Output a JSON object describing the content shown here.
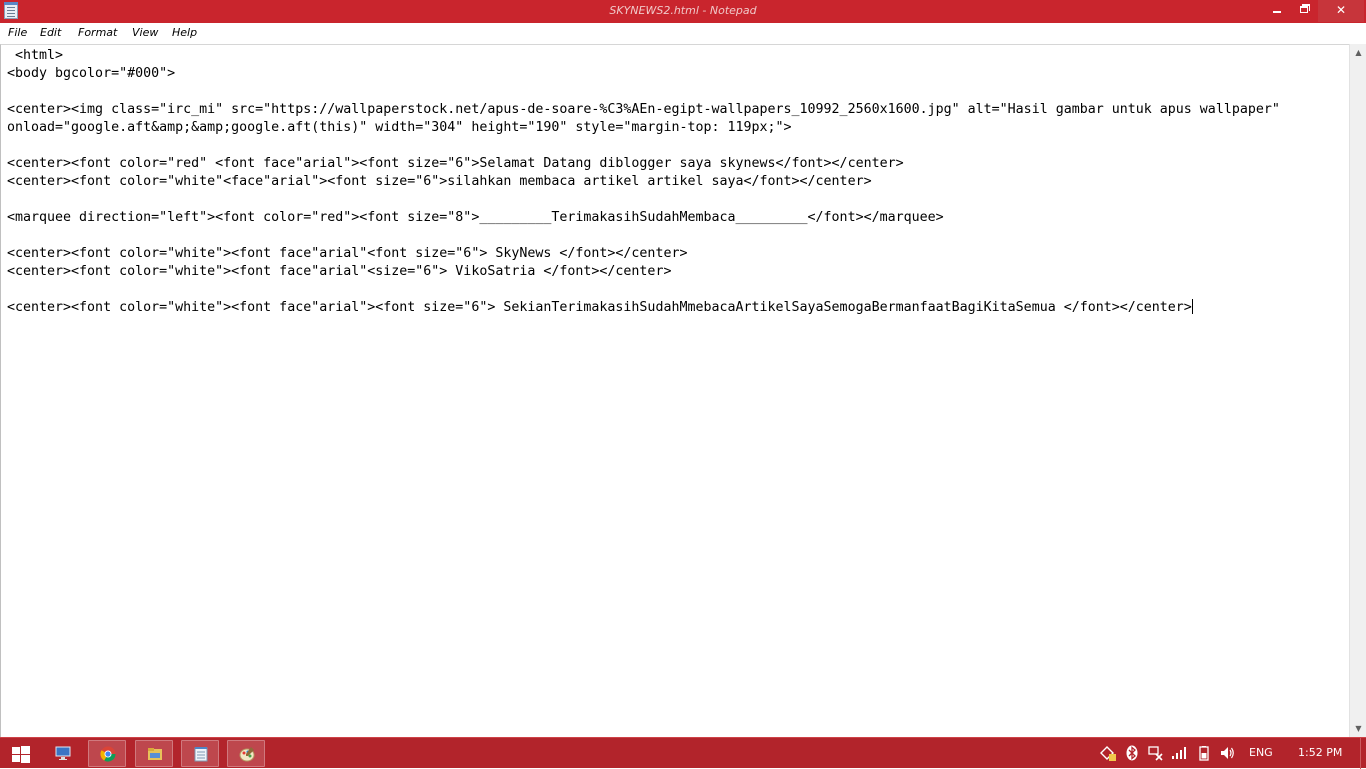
{
  "window": {
    "title": "SKYNEWS2.html - Notepad",
    "accent_color": "#c9252d",
    "controls": [
      "minimize-icon",
      "restore-icon",
      "close-icon"
    ],
    "close_glyph": "✕"
  },
  "menu": {
    "file": "File",
    "edit": "Edit",
    "format": "Format",
    "view": "View",
    "help": "Help"
  },
  "editor": {
    "font": "monospace",
    "lines": [
      " <html>",
      "<body bgcolor=\"#000\">",
      "",
      "<center><img class=\"irc_mi\" src=\"https://wallpaperstock.net/apus-de-soare-%C3%AEn-egipt-wallpapers_10992_2560x1600.jpg\" alt=\"Hasil gambar untuk apus wallpaper\"",
      "onload=\"google.aft&amp;&amp;google.aft(this)\" width=\"304\" height=\"190\" style=\"margin-top: 119px;\">",
      "",
      "<center><font color=\"red\" <font face\"arial\"><font size=\"6\">Selamat Datang diblogger saya skynews</font></center>",
      "<center><font color=\"white\"<face\"arial\"><font size=\"6\">silahkan membaca artikel artikel saya</font></center>",
      "",
      "<marquee direction=\"left\"><font color=\"red\"><font size=\"8\">_________TerimakasihSudahMembaca_________</font></marquee>",
      "",
      "<center><font color=\"white\"><font face\"arial\"<font size=\"6\"> SkyNews </font></center>",
      "<center><font color=\"white\"><font face\"arial\"<size=\"6\"> VikoSatria </font></center>",
      "",
      "<center><font color=\"white\"><font face\"arial\"><font size=\"6\"> SekianTerimakasihSudahMmebacaArtikelSayaSemogaBermanfaatBagiKitaSemua </font></center>"
    ]
  },
  "scrollbar": {
    "up_arrow": "▲",
    "down_arrow": "▼"
  },
  "taskbar": {
    "background": "#b2242b",
    "apps": [
      {
        "name": "computer-icon",
        "active": false
      },
      {
        "name": "chrome-icon",
        "active": false
      },
      {
        "name": "file-explorer-icon",
        "active": false
      },
      {
        "name": "notepad-icon",
        "active": true
      },
      {
        "name": "paint-icon",
        "active": false
      }
    ],
    "tray": {
      "language": "ENG",
      "time": "1:52 PM",
      "icons": [
        "action-center-icon",
        "bluetooth-icon",
        "network-icon",
        "signal-icon",
        "battery-icon",
        "volume-icon"
      ]
    }
  }
}
